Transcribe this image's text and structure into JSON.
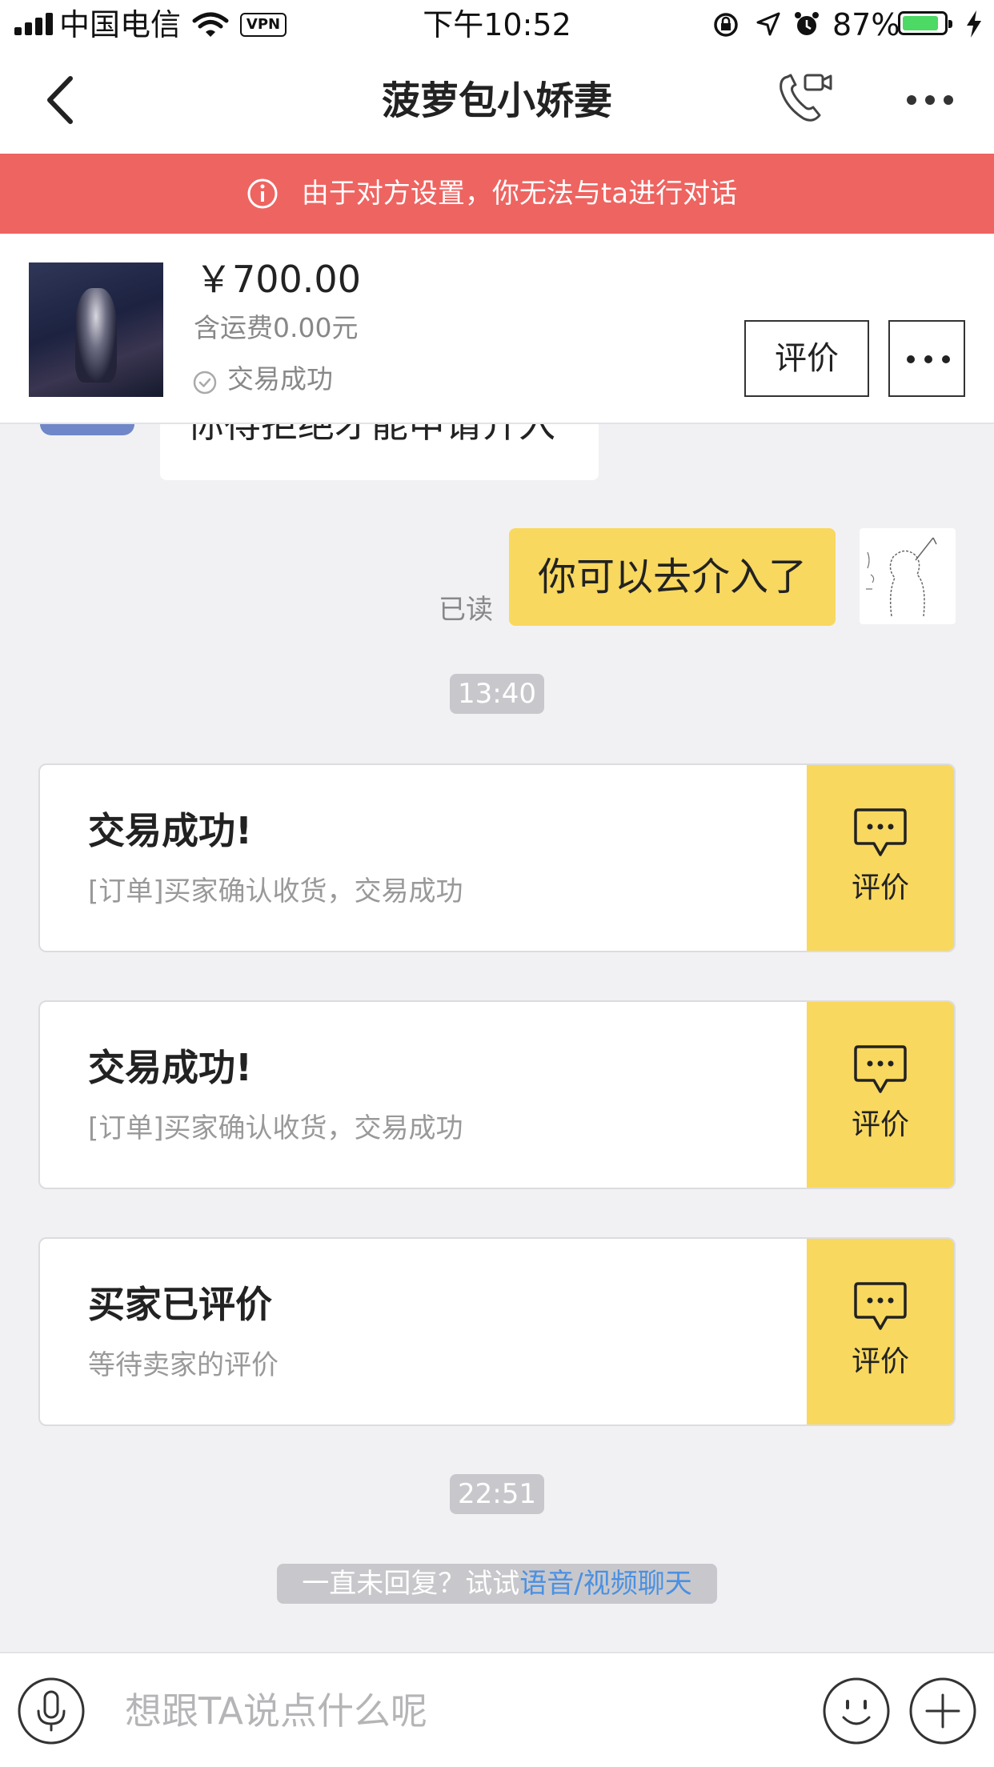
{
  "status_bar": {
    "carrier": "中国电信",
    "vpn": "VPN",
    "time": "下午10:52",
    "battery_percent": "87%",
    "battery_level": 0.87
  },
  "nav": {
    "title": "菠萝包小娇妻"
  },
  "banner": {
    "text": "由于对方设置，你无法与ta进行对话"
  },
  "product": {
    "price": "￥700.00",
    "shipping": "含运费0.00元",
    "status": "交易成功",
    "review_button": "评价"
  },
  "messages": {
    "partial_text": "你得拒绝才能申请介入",
    "read_status": "已读",
    "my_message": "你可以去介入了"
  },
  "timestamps": [
    "13:40",
    "22:51"
  ],
  "cards": [
    {
      "title": "交易成功!",
      "subtitle": "[订单]买家确认收货，交易成功",
      "action": "评价"
    },
    {
      "title": "交易成功!",
      "subtitle": "[订单]买家确认收货，交易成功",
      "action": "评价"
    },
    {
      "title": "买家已评价",
      "subtitle": "等待卖家的评价",
      "action": "评价"
    }
  ],
  "hint": {
    "prefix": "一直未回复？试试",
    "link": "语音/视频聊天"
  },
  "input": {
    "placeholder": "想跟TA说点什么呢"
  },
  "colors": {
    "banner_bg": "#ee6461",
    "accent_yellow": "#f8d85e",
    "link_blue": "#4a90e2",
    "page_bg": "#f1f1f4"
  },
  "icons": [
    "signal-icon",
    "wifi-icon",
    "back-icon",
    "video-call-icon",
    "more-icon",
    "info-icon",
    "check-circle-icon",
    "comment-icon",
    "microphone-icon",
    "emoji-icon",
    "plus-icon"
  ]
}
